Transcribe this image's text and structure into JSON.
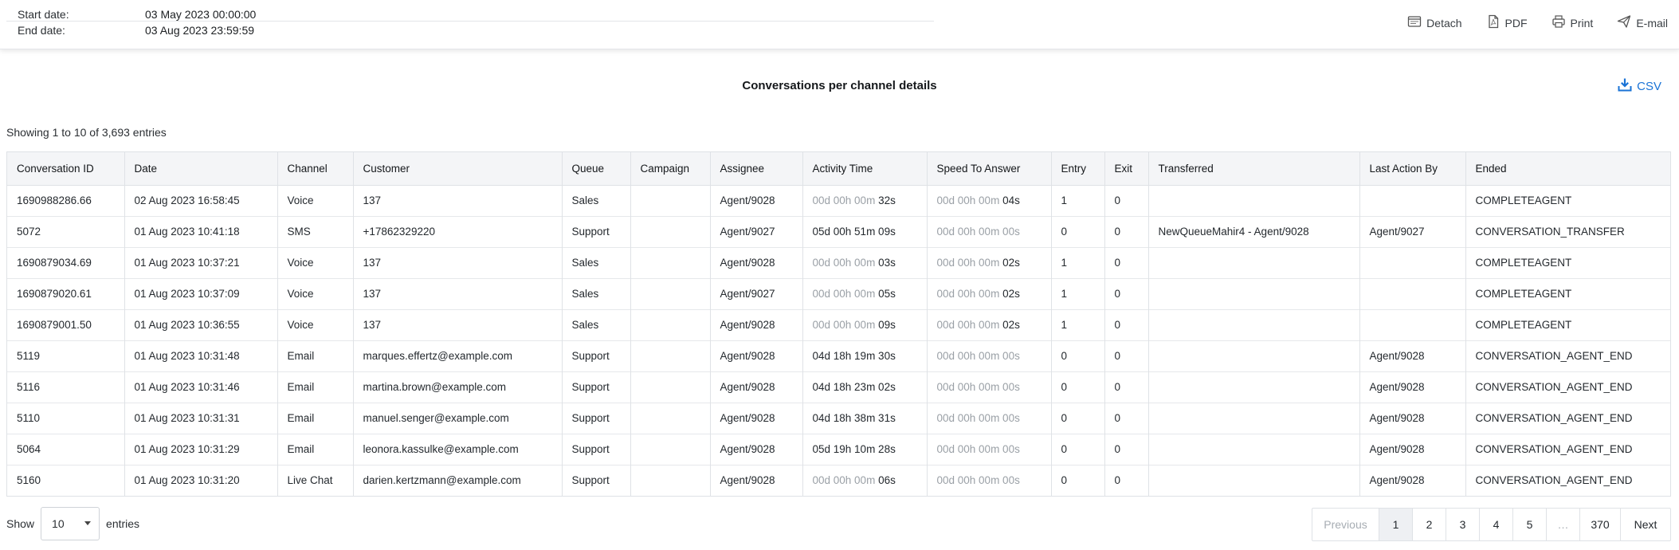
{
  "filters": {
    "start_label": "Start date:",
    "start_value": "03 May 2023 00:00:00",
    "end_label": "End date:",
    "end_value": "03 Aug 2023 23:59:59"
  },
  "actions": {
    "detach": "Detach",
    "pdf": "PDF",
    "print": "Print",
    "email": "E-mail"
  },
  "report": {
    "title": "Conversations per channel details",
    "csv_label": "CSV",
    "showing": "Showing 1 to 10 of 3,693 entries"
  },
  "table": {
    "columns": [
      "Conversation ID",
      "Date",
      "Channel",
      "Customer",
      "Queue",
      "Campaign",
      "Assignee",
      "Activity Time",
      "Speed To Answer",
      "Entry",
      "Exit",
      "Transferred",
      "Last Action By",
      "Ended"
    ],
    "rows": [
      {
        "id": "1690988286.66",
        "date": "02 Aug 2023 16:58:45",
        "channel": "Voice",
        "customer": "137",
        "queue": "Sales",
        "campaign": "",
        "assignee": "Agent/9028",
        "act_pre": "00d 00h 00m ",
        "act_post": "32s",
        "spd_pre": "00d 00h 00m ",
        "spd_post": "04s",
        "entry": "1",
        "exit": "0",
        "transferred": "",
        "last": "",
        "ended": "COMPLETEAGENT"
      },
      {
        "id": "5072",
        "date": "01 Aug 2023 10:41:18",
        "channel": "SMS",
        "customer": "+17862329220",
        "queue": "Support",
        "campaign": "",
        "assignee": "Agent/9027",
        "act_pre": "",
        "act_post": "05d 00h 51m 09s",
        "spd_pre": "00d 00h 00m 00s",
        "spd_post": "",
        "entry": "0",
        "exit": "0",
        "transferred": "NewQueueMahir4 - Agent/9028",
        "last": "Agent/9027",
        "ended": "CONVERSATION_TRANSFER"
      },
      {
        "id": "1690879034.69",
        "date": "01 Aug 2023 10:37:21",
        "channel": "Voice",
        "customer": "137",
        "queue": "Sales",
        "campaign": "",
        "assignee": "Agent/9028",
        "act_pre": "00d 00h 00m ",
        "act_post": "03s",
        "spd_pre": "00d 00h 00m ",
        "spd_post": "02s",
        "entry": "1",
        "exit": "0",
        "transferred": "",
        "last": "",
        "ended": "COMPLETEAGENT"
      },
      {
        "id": "1690879020.61",
        "date": "01 Aug 2023 10:37:09",
        "channel": "Voice",
        "customer": "137",
        "queue": "Sales",
        "campaign": "",
        "assignee": "Agent/9027",
        "act_pre": "00d 00h 00m ",
        "act_post": "05s",
        "spd_pre": "00d 00h 00m ",
        "spd_post": "02s",
        "entry": "1",
        "exit": "0",
        "transferred": "",
        "last": "",
        "ended": "COMPLETEAGENT"
      },
      {
        "id": "1690879001.50",
        "date": "01 Aug 2023 10:36:55",
        "channel": "Voice",
        "customer": "137",
        "queue": "Sales",
        "campaign": "",
        "assignee": "Agent/9028",
        "act_pre": "00d 00h 00m ",
        "act_post": "09s",
        "spd_pre": "00d 00h 00m ",
        "spd_post": "02s",
        "entry": "1",
        "exit": "0",
        "transferred": "",
        "last": "",
        "ended": "COMPLETEAGENT"
      },
      {
        "id": "5119",
        "date": "01 Aug 2023 10:31:48",
        "channel": "Email",
        "customer": "marques.effertz@example.com",
        "queue": "Support",
        "campaign": "",
        "assignee": "Agent/9028",
        "act_pre": "",
        "act_post": "04d 18h 19m 30s",
        "spd_pre": "00d 00h 00m 00s",
        "spd_post": "",
        "entry": "0",
        "exit": "0",
        "transferred": "",
        "last": "Agent/9028",
        "ended": "CONVERSATION_AGENT_END"
      },
      {
        "id": "5116",
        "date": "01 Aug 2023 10:31:46",
        "channel": "Email",
        "customer": "martina.brown@example.com",
        "queue": "Support",
        "campaign": "",
        "assignee": "Agent/9028",
        "act_pre": "",
        "act_post": "04d 18h 23m 02s",
        "spd_pre": "00d 00h 00m 00s",
        "spd_post": "",
        "entry": "0",
        "exit": "0",
        "transferred": "",
        "last": "Agent/9028",
        "ended": "CONVERSATION_AGENT_END"
      },
      {
        "id": "5110",
        "date": "01 Aug 2023 10:31:31",
        "channel": "Email",
        "customer": "manuel.senger@example.com",
        "queue": "Support",
        "campaign": "",
        "assignee": "Agent/9028",
        "act_pre": "",
        "act_post": "04d 18h 38m 31s",
        "spd_pre": "00d 00h 00m 00s",
        "spd_post": "",
        "entry": "0",
        "exit": "0",
        "transferred": "",
        "last": "Agent/9028",
        "ended": "CONVERSATION_AGENT_END"
      },
      {
        "id": "5064",
        "date": "01 Aug 2023 10:31:29",
        "channel": "Email",
        "customer": "leonora.kassulke@example.com",
        "queue": "Support",
        "campaign": "",
        "assignee": "Agent/9028",
        "act_pre": "",
        "act_post": "05d 19h 10m 28s",
        "spd_pre": "00d 00h 00m 00s",
        "spd_post": "",
        "entry": "0",
        "exit": "0",
        "transferred": "",
        "last": "Agent/9028",
        "ended": "CONVERSATION_AGENT_END"
      },
      {
        "id": "5160",
        "date": "01 Aug 2023 10:31:20",
        "channel": "Live Chat",
        "customer": "darien.kertzmann@example.com",
        "queue": "Support",
        "campaign": "",
        "assignee": "Agent/9028",
        "act_pre": "00d 00h 00m ",
        "act_post": "06s",
        "spd_pre": "00d 00h 00m 00s",
        "spd_post": "",
        "entry": "0",
        "exit": "0",
        "transferred": "",
        "last": "Agent/9028",
        "ended": "CONVERSATION_AGENT_END"
      }
    ]
  },
  "footer": {
    "show_label": "Show",
    "page_size": "10",
    "entries_label": "entries",
    "pagination": {
      "previous": "Previous",
      "pages": [
        "1",
        "2",
        "3",
        "4",
        "5"
      ],
      "ellipsis": "…",
      "last": "370",
      "next": "Next",
      "active_page": "1"
    }
  }
}
